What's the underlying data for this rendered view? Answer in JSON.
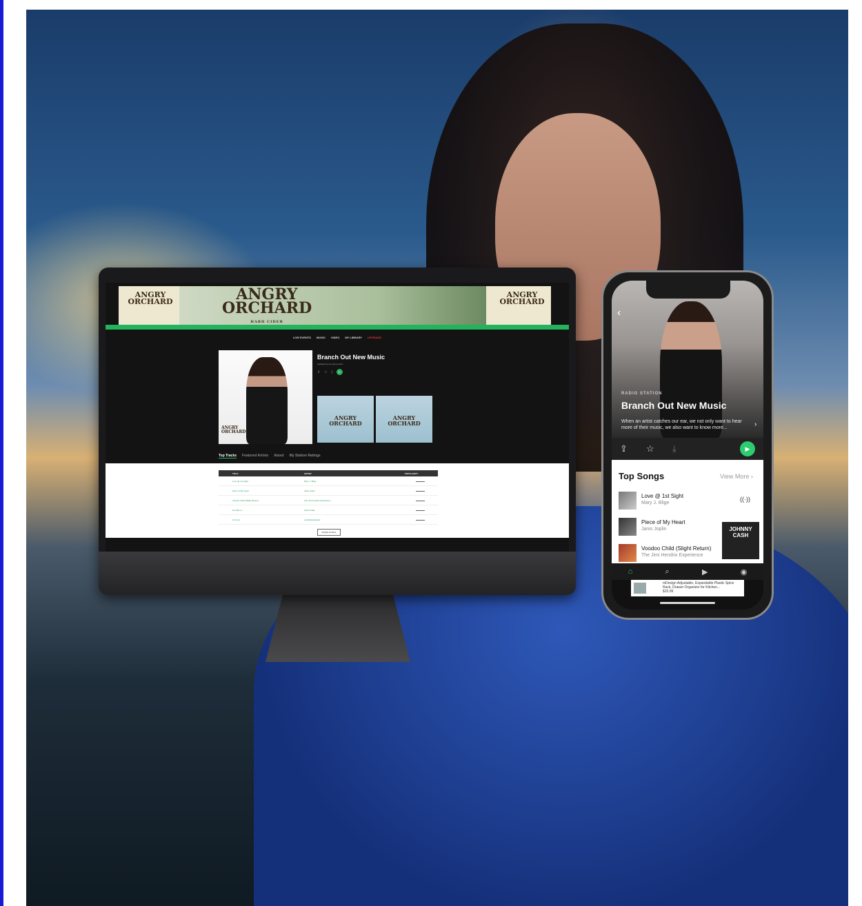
{
  "ad": {
    "brand_line1": "ANGRY",
    "brand_line2": "ORCHARD",
    "sub": "HARD CIDER"
  },
  "desktop": {
    "nav": [
      "LIVE EVENTS",
      "MUSIC",
      "VIDEO",
      "MY LIBRARY",
      "UPGRADE"
    ],
    "station_title": "Branch Out New Music",
    "station_subtitle": "highlighting emerging artists",
    "tabs": [
      "Top Tracks",
      "Featured Artists",
      "About",
      "My Station Ratings"
    ],
    "columns": [
      "TITLE",
      "ARTIST",
      "POPULARITY"
    ],
    "rows": [
      {
        "title": "Love @ 1st Sight",
        "artist": "Mary J. Blige",
        "popularity": "▬▬▬▬▬"
      },
      {
        "title": "Piece of My Heart",
        "artist": "Janis Joplin",
        "popularity": "▬▬▬▬▬"
      },
      {
        "title": "Voodoo Child (Slight Return)",
        "artist": "The Jimi Hendrix Experience",
        "popularity": "▬▬▬▬▬"
      },
      {
        "title": "He Was Lo",
        "artist": "Keith Urban",
        "popularity": "▬▬▬▬▬"
      },
      {
        "title": "A Funny",
        "artist": "Ludmilla Edouard",
        "popularity": "▬▬▬▬▬"
      }
    ],
    "more_button": "MORE SONGS"
  },
  "phone": {
    "label": "RADIO STATION",
    "title": "Branch Out New Music",
    "description": "When an artist catches our ear, we not only want to hear more of their music, we also want to know more...",
    "top_songs": "Top Songs",
    "view_more": "View More",
    "songs": [
      {
        "title": "Love @ 1st Sight",
        "artist": "Mary J. Blige"
      },
      {
        "title": "Piece of My Heart",
        "artist": "Janis Joplin"
      },
      {
        "title": "Voodoo Child (Slight Return)",
        "artist": "The Jimi Hendrix Experience"
      }
    ],
    "album_text": "JOHNNY CASH",
    "ad_text": "mDesign Adjustable, Expandable Plastic Spice Rack, Drawer Organizer for Kitchen...",
    "ad_price": "$15.99"
  }
}
